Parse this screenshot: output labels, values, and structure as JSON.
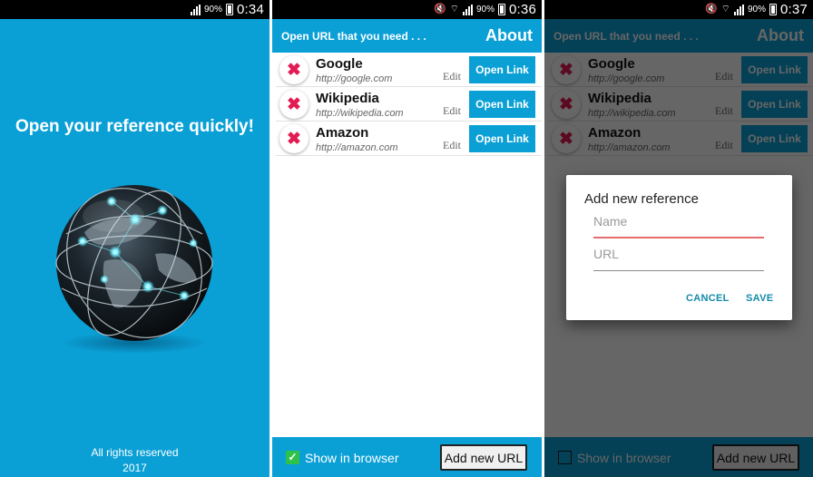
{
  "status": {
    "battery_pct": "90%",
    "times": [
      "0:34",
      "0:36",
      "0:37"
    ]
  },
  "splash": {
    "title": "Open your reference quickly!",
    "footer_line1": "All rights reserved",
    "footer_line2": "2017"
  },
  "app": {
    "subtitle": "Open URL that you need . . .",
    "about_label": "About",
    "edit_label": "Edit",
    "open_link_label": "Open Link",
    "delete_glyph": "✖",
    "items": [
      {
        "name": "Google",
        "url": "http://google.com"
      },
      {
        "name": "Wikipedia",
        "url": "http://wikipedia.com"
      },
      {
        "name": "Amazon",
        "url": "http://amazon.com"
      }
    ],
    "show_in_browser_label": "Show in browser",
    "show_in_browser_checked_screen2": true,
    "show_in_browser_checked_screen3": false,
    "check_glyph": "✓",
    "add_new_url_label": "Add new URL"
  },
  "dialog": {
    "title": "Add new reference",
    "name_placeholder": "Name",
    "url_placeholder": "URL",
    "cancel_label": "CANCEL",
    "save_label": "SAVE"
  },
  "colors": {
    "accent": "#0aa0d6",
    "delete_red": "#e31b53",
    "checkbox_green": "#2ec24a",
    "dialog_button": "#138aa8",
    "focus_underline": "#e46b6b"
  }
}
